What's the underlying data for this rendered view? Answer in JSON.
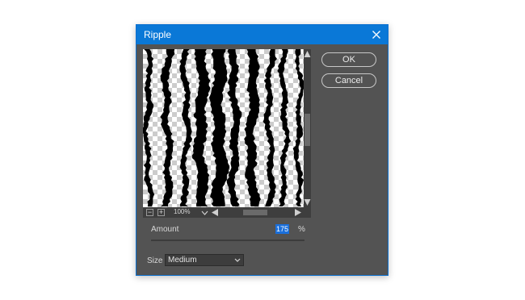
{
  "dialog": {
    "title": "Ripple",
    "close_icon": "close-icon",
    "titlebar_color": "#0a78d7",
    "background_color": "#535353"
  },
  "preview": {
    "zoom_value": "100%",
    "zoom_out_glyph": "−",
    "zoom_in_glyph": "+"
  },
  "buttons": {
    "ok": "OK",
    "cancel": "Cancel"
  },
  "amount": {
    "label": "Amount",
    "value": "175",
    "unit": "%",
    "slider_fraction": 0.58,
    "highlight_color": "#1a6fdb"
  },
  "size": {
    "label": "Size",
    "selected": "Medium"
  }
}
